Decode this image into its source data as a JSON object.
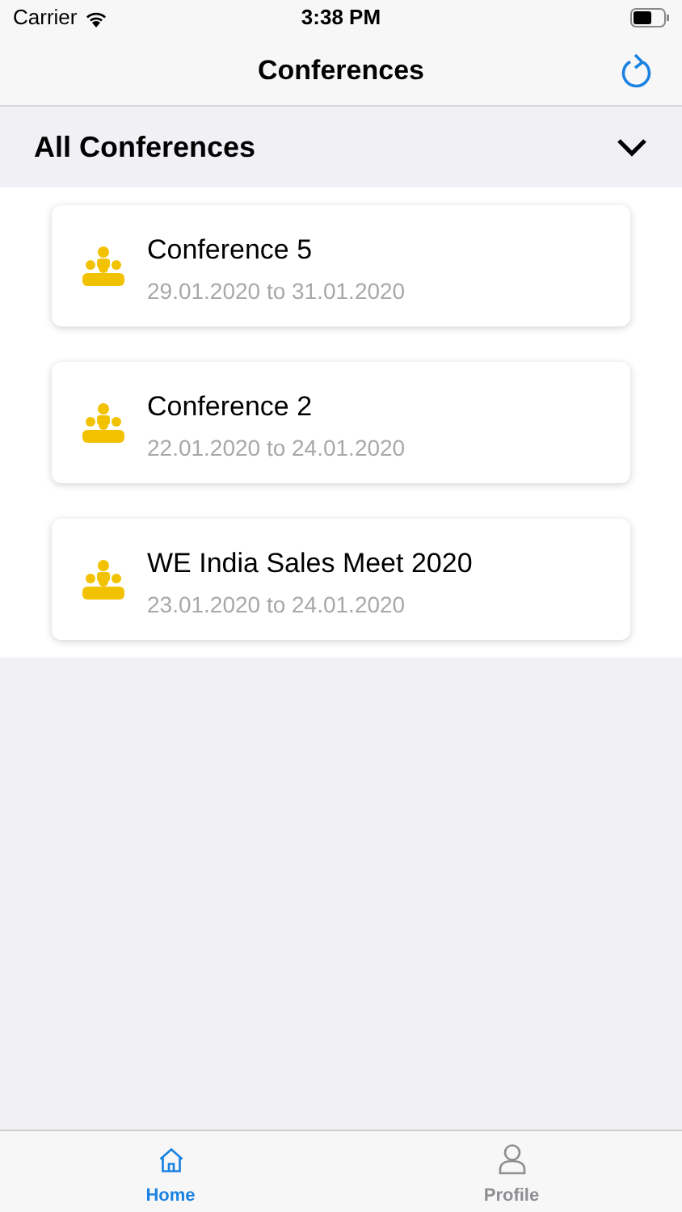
{
  "status_bar": {
    "carrier": "Carrier",
    "time": "3:38 PM"
  },
  "nav_bar": {
    "title": "Conferences"
  },
  "section": {
    "title": "All Conferences",
    "expanded": true
  },
  "conferences": [
    {
      "name": "Conference 5",
      "dates": "29.01.2020 to 31.01.2020"
    },
    {
      "name": "Conference 2",
      "dates": "22.01.2020 to 24.01.2020"
    },
    {
      "name": "WE India Sales Meet 2020",
      "dates": "23.01.2020 to 24.01.2020"
    }
  ],
  "tab_bar": [
    {
      "label": "Home",
      "selected": true
    },
    {
      "label": "Profile",
      "selected": false
    }
  ]
}
